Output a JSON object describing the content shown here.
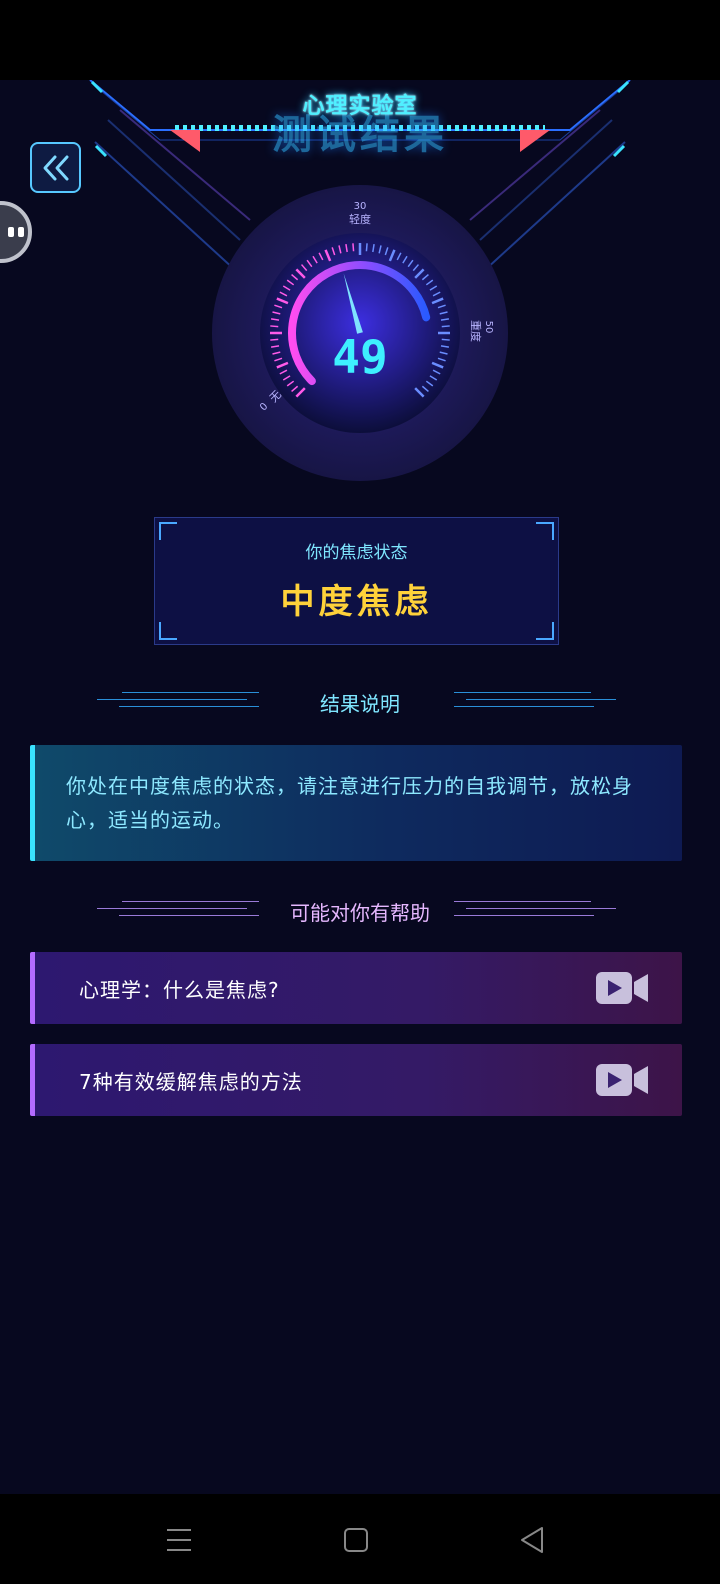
{
  "header": {
    "title": "心理实验室",
    "ghost_title": "测试结果"
  },
  "gauge": {
    "value": "49",
    "max": 100,
    "tick_top_number": "30",
    "tick_top_label": "轻度",
    "tick_right_number": "50",
    "tick_right_label": "重度",
    "tick_left_number": "0",
    "tick_left_label": "无"
  },
  "state": {
    "label": "你的焦虑状态",
    "value": "中度焦虑"
  },
  "result": {
    "heading": "结果说明",
    "text": "你处在中度焦虑的状态，请注意进行压力的自我调节，放松身心，适当的运动。"
  },
  "help": {
    "heading": "可能对你有帮助",
    "items": [
      {
        "label": "心理学：什么是焦虑?"
      },
      {
        "label": "7种有效缓解焦虑的方法"
      }
    ]
  },
  "colors": {
    "accent_cyan": "#3ae3ff",
    "accent_yellow": "#ffd23a",
    "accent_purple": "#b46bff",
    "background": "#07081f"
  },
  "icons": {
    "back": "double-chevron-left-icon",
    "video": "video-camera-icon"
  }
}
